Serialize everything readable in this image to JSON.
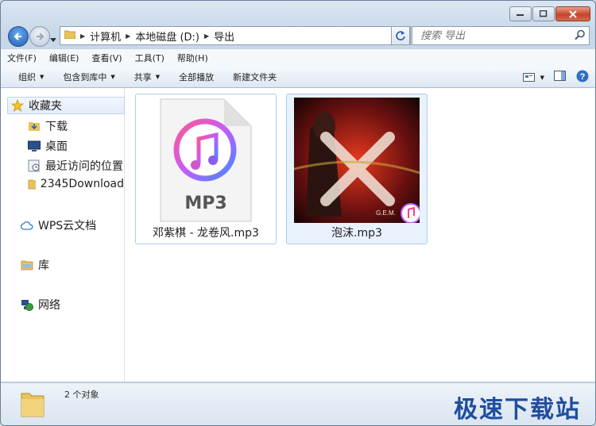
{
  "address": {
    "crumbs": [
      "计算机",
      "本地磁盘 (D:)",
      "导出"
    ]
  },
  "search": {
    "placeholder": "搜索 导出"
  },
  "menu": [
    "文件(F)",
    "编辑(E)",
    "查看(V)",
    "工具(T)",
    "帮助(H)"
  ],
  "toolbar": {
    "organize": "组织",
    "include_library": "包含到库中",
    "share": "共享",
    "play_all": "全部播放",
    "new_folder": "新建文件夹"
  },
  "sidebar": {
    "favorites": "收藏夹",
    "downloads": "下载",
    "desktop": "桌面",
    "recent": "最近访问的位置",
    "folder_2345": "2345Download",
    "wps": "WPS云文档",
    "library": "库",
    "network": "网络"
  },
  "files": [
    {
      "name": "邓紫棋 - 龙卷风.mp3",
      "thumb_text": "MP3"
    },
    {
      "name": "泡沫.mp3",
      "thumb_text": "G.E.M."
    }
  ],
  "status": {
    "count": "2 个对象"
  },
  "watermark": "极速下载站",
  "colors": {
    "accent": "#1f5fb6",
    "music_pink": "#ff3b8e",
    "music_blue": "#3f8cff"
  }
}
